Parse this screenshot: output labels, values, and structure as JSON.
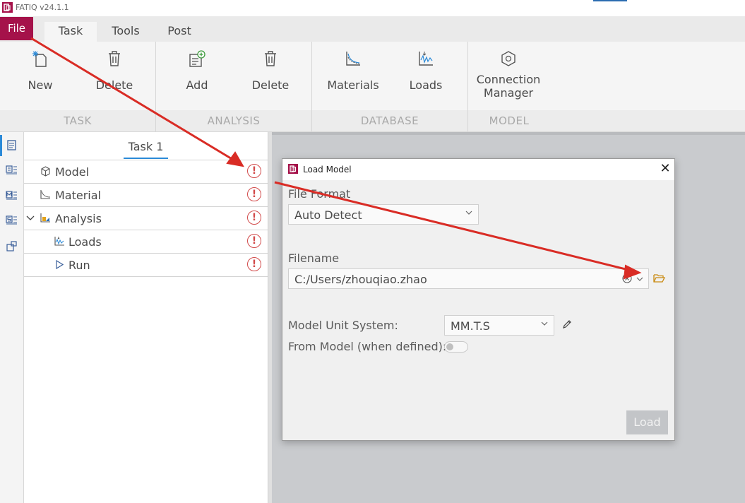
{
  "app": {
    "title": "FATIQ v24.1.1",
    "file_label": "File"
  },
  "tabs": [
    {
      "label": "Task",
      "active": true
    },
    {
      "label": "Tools",
      "active": false
    },
    {
      "label": "Post",
      "active": false
    }
  ],
  "ribbon": {
    "task": {
      "group": "TASK",
      "new": "New",
      "delete": "Delete"
    },
    "analysis": {
      "group": "ANALYSIS",
      "add": "Add",
      "delete": "Delete"
    },
    "database": {
      "group": "DATABASE",
      "materials": "Materials",
      "loads": "Loads"
    },
    "model": {
      "group": "MODEL",
      "connection_line1": "Connection",
      "connection_line2": "Manager"
    }
  },
  "tree": {
    "tab_label": "Task 1",
    "items": [
      {
        "label": "Model",
        "status": "!"
      },
      {
        "label": "Material",
        "status": "!"
      },
      {
        "label": "Analysis",
        "status": "!"
      },
      {
        "label": "Loads",
        "status": "!"
      },
      {
        "label": "Run",
        "status": "!"
      }
    ]
  },
  "dialog": {
    "title": "Load Model",
    "close": "✕",
    "file_format_label": "File Format",
    "file_format_value": "Auto Detect",
    "filename_label": "Filename",
    "filename_value": "C:/Users/zhouqiao.zhao",
    "unit_system_label": "Model Unit System:",
    "unit_system_value": "MM.T.S",
    "from_model_label": "From Model (when defined):",
    "from_model_on": false,
    "load_button": "Load"
  },
  "colors": {
    "brand": "#a5124a",
    "accent": "#2b8ad8",
    "warning": "#d24b4b",
    "annotation_arrow": "#d92c25"
  }
}
